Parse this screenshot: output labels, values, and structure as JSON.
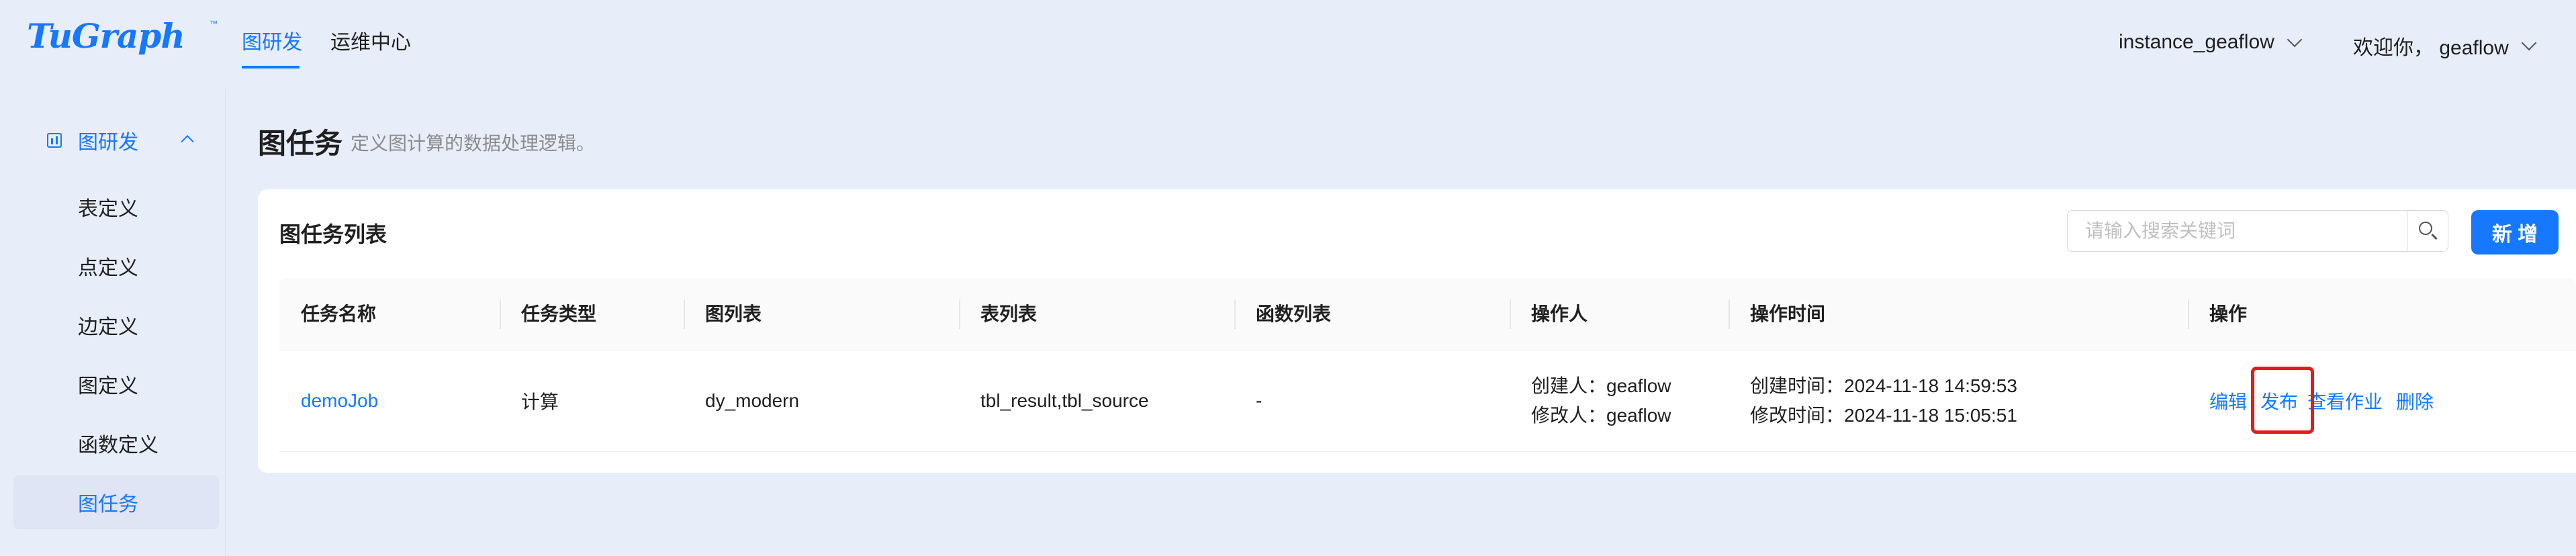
{
  "header": {
    "logo": "TuGraph",
    "logo_tm": "™",
    "nav": [
      {
        "label": "图研发",
        "active": true
      },
      {
        "label": "运维中心",
        "active": false
      }
    ],
    "instance": "instance_geaflow",
    "greeting": "欢迎你， geaflow"
  },
  "sidebar": {
    "group_label": "图研发",
    "items": [
      {
        "label": "表定义",
        "active": false
      },
      {
        "label": "点定义",
        "active": false
      },
      {
        "label": "边定义",
        "active": false
      },
      {
        "label": "图定义",
        "active": false
      },
      {
        "label": "函数定义",
        "active": false
      },
      {
        "label": "图任务",
        "active": true
      }
    ]
  },
  "page": {
    "title": "图任务",
    "description": "定义图计算的数据处理逻辑。"
  },
  "card": {
    "title": "图任务列表",
    "search_placeholder": "请输入搜索关键词",
    "add_label": "新 增"
  },
  "table": {
    "columns": [
      "任务名称",
      "任务类型",
      "图列表",
      "表列表",
      "函数列表",
      "操作人",
      "操作时间",
      "操作"
    ],
    "rows": [
      {
        "name": "demoJob",
        "type": "计算",
        "graphs": "dy_modern",
        "tables": "tbl_result,tbl_source",
        "functions": "-",
        "creator": "创建人：geaflow",
        "modifier": "修改人：geaflow",
        "created": "创建时间：2024-11-18 14:59:53",
        "modified": "修改时间：2024-11-18 15:05:51",
        "actions": {
          "edit": "编辑",
          "publish": "发布",
          "view": "查看作业",
          "delete": "删除"
        }
      }
    ]
  },
  "colors": {
    "accent": "#1677ff",
    "highlight": "#e01c1c",
    "background": "#e8edfa"
  }
}
